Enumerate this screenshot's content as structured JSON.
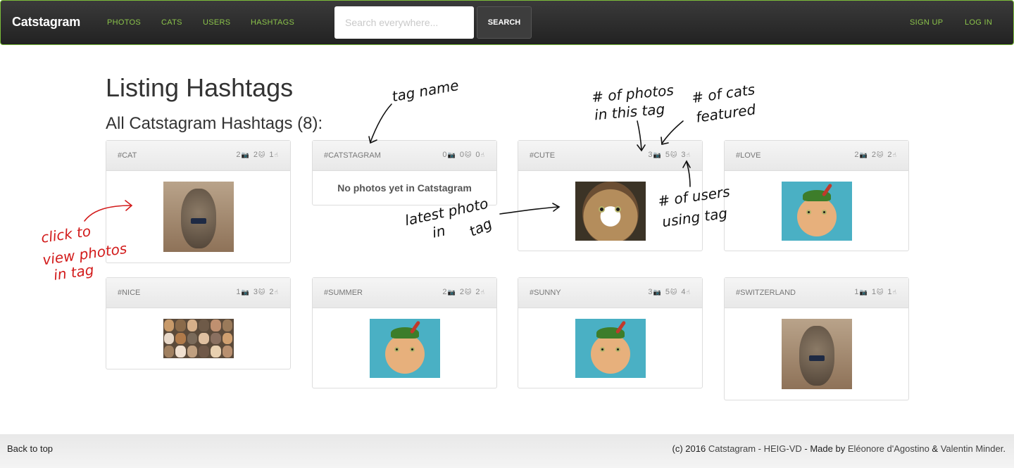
{
  "navbar": {
    "brand": "Catstagram",
    "links": [
      "PHOTOS",
      "CATS",
      "USERS",
      "HASHTAGS"
    ],
    "search_placeholder": "Search everywhere...",
    "search_button": "SEARCH",
    "signup": "SIGN UP",
    "login": "LOG IN"
  },
  "page": {
    "title": "Listing Hashtags",
    "subtitle": "All Catstagram Hashtags (8):"
  },
  "hashtags": [
    {
      "name": "#CAT",
      "photos": "2",
      "cats": "2",
      "users": "1",
      "image": "kitten"
    },
    {
      "name": "#CATSTAGRAM",
      "photos": "0",
      "cats": "0",
      "users": "0",
      "empty_message": "No photos yet in Catstagram"
    },
    {
      "name": "#CUTE",
      "photos": "3",
      "cats": "5",
      "users": "3",
      "image": "tabby"
    },
    {
      "name": "#LOVE",
      "photos": "2",
      "cats": "2",
      "users": "2",
      "image": "hat-cat"
    },
    {
      "name": "#NICE",
      "photos": "1",
      "cats": "3",
      "users": "2",
      "image": "many-cats"
    },
    {
      "name": "#SUMMER",
      "photos": "2",
      "cats": "2",
      "users": "2",
      "image": "hat-cat"
    },
    {
      "name": "#SUNNY",
      "photos": "3",
      "cats": "5",
      "users": "4",
      "image": "hat-cat"
    },
    {
      "name": "#SWITZERLAND",
      "photos": "1",
      "cats": "1",
      "users": "1",
      "image": "kitten"
    }
  ],
  "icons": {
    "photo": "camera-icon",
    "cat": "cat-icon",
    "user": "hand-icon"
  },
  "annotations": {
    "tag_name": "tag name",
    "photos_in_tag": [
      "# of photos",
      "in this tag"
    ],
    "cats_featured": [
      "# of cats",
      "featured"
    ],
    "latest_photo": [
      "latest photo",
      "in",
      "tag"
    ],
    "users_using": [
      "# of users",
      "using tag"
    ],
    "click_to_view": [
      "click to",
      "view photos",
      "in tag"
    ]
  },
  "footer": {
    "back_to_top": "Back to top",
    "credits_prefix": "(c) 2016",
    "credits_app": "Catstagram - HEIG-VD",
    "credits_made_by": "- Made by",
    "author1": "Eléonore d'Agostino",
    "and": "&",
    "author2": "Valentin Minder",
    "end": "."
  },
  "colors": {
    "accent": "#8bc34a",
    "navbar": "#2b2b2b",
    "annotation_red": "#d21a1a"
  }
}
